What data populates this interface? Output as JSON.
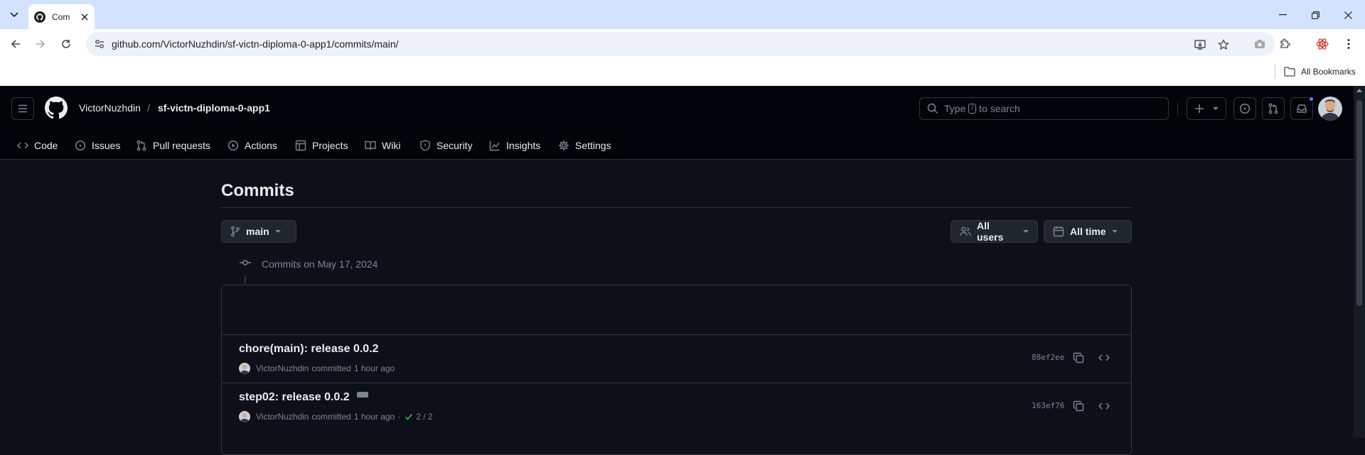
{
  "browser": {
    "tab_title": "Com",
    "url": "github.com/VictorNuzhdin/sf-victn-diploma-0-app1/commits/main/",
    "bookmarks_label": "All Bookmarks"
  },
  "header": {
    "owner": "VictorNuzhdin",
    "separator": "/",
    "repo": "sf-victn-diploma-0-app1",
    "search_prefix": "Type",
    "search_key": "/",
    "search_suffix": "to search"
  },
  "repo_nav": [
    {
      "label": "Code",
      "icon": "code-icon"
    },
    {
      "label": "Issues",
      "icon": "issue-opened-icon"
    },
    {
      "label": "Pull requests",
      "icon": "pull-request-icon"
    },
    {
      "label": "Actions",
      "icon": "play-icon"
    },
    {
      "label": "Projects",
      "icon": "table-icon"
    },
    {
      "label": "Wiki",
      "icon": "book-icon"
    },
    {
      "label": "Security",
      "icon": "shield-icon"
    },
    {
      "label": "Insights",
      "icon": "graph-icon"
    },
    {
      "label": "Settings",
      "icon": "gear-icon"
    }
  ],
  "page": {
    "title": "Commits",
    "branch": "main",
    "users_filter": "All users",
    "time_filter": "All time",
    "date_group": "Commits on May 17, 2024"
  },
  "commits": [
    {
      "message": "chore(main): release 0.0.2",
      "author": "VictorNuzhdin",
      "action": "committed",
      "time": "1 hour ago",
      "sha": "88ef2ee",
      "checks": ""
    },
    {
      "message": "step02: release 0.0.2",
      "author": "VictorNuzhdin",
      "action": "committed",
      "time": "1 hour ago",
      "sha": "163ef76",
      "checks": "2 / 2"
    }
  ],
  "colors": {
    "canvas": "#0d1117",
    "header": "#010409",
    "border": "#30363d",
    "text": "#e6edf3",
    "muted": "#7d8590",
    "success": "#3fb950",
    "accent": "#4493f8"
  }
}
